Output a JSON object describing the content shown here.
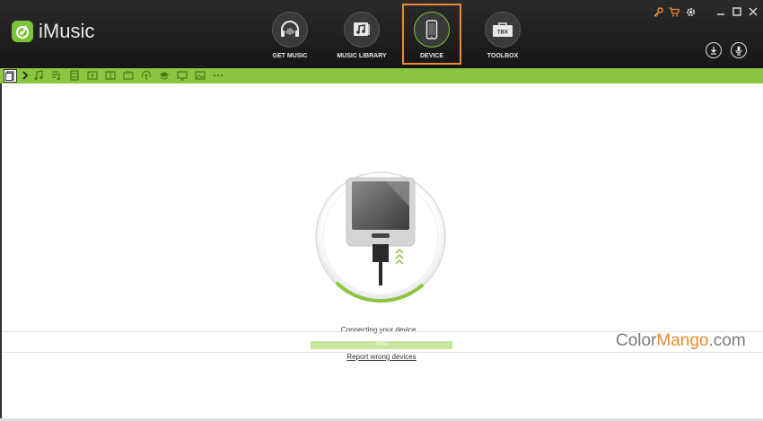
{
  "app": {
    "name": "iMusic"
  },
  "nav": [
    {
      "label": "GET MUSIC",
      "icon": "headphones-icon",
      "active": false
    },
    {
      "label": "MUSIC LIBRARY",
      "icon": "music-library-icon",
      "active": false
    },
    {
      "label": "DEVICE",
      "icon": "phone-icon",
      "active": true
    },
    {
      "label": "TOOLBOX",
      "icon": "toolbox-icon",
      "active": false
    }
  ],
  "toolbox_badge": "TBX",
  "toolbar": {
    "icons": [
      "device-icon",
      "chevron-right-icon",
      "music-note-icon",
      "playlist-icon",
      "film-icon",
      "video-icon",
      "book-icon",
      "tv-icon",
      "podcast-icon",
      "graduation-cap-icon",
      "monitor-icon",
      "photo-icon",
      "more-icon"
    ]
  },
  "status": {
    "message": "Connecting your device...",
    "progress_percent": 100,
    "progress_label": "100%",
    "report_link": "Report wrong devices"
  },
  "watermark": {
    "part1": "Color",
    "part2": "Mango",
    "part3": ".com"
  },
  "colors": {
    "accent_green": "#8ac63f",
    "active_border": "#f08a30",
    "titlebar": "#1f1f1f"
  }
}
